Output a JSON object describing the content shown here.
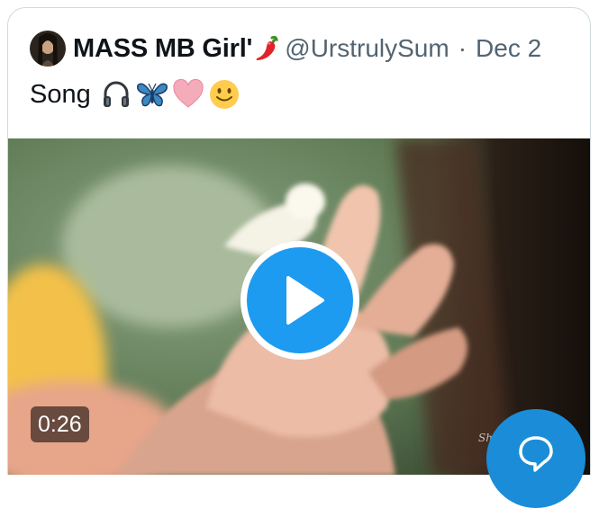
{
  "tweet": {
    "display_name": "MASS MB Girl'",
    "name_emoji_icon": "chili-pepper-icon",
    "handle": "@UrstrulySum",
    "separator": "·",
    "date": "Dec 2",
    "text": "Song",
    "text_emoji_icons": [
      "headphones-icon",
      "butterfly-icon",
      "pink-heart-icon",
      "slightly-smiling-face-icon"
    ]
  },
  "media": {
    "type": "video",
    "duration": "0:26",
    "watermark": "Shiva ka",
    "play_icon": "play-icon"
  },
  "fab": {
    "icon": "chat-bubble-icon"
  },
  "colors": {
    "accent": "#1d9bf0",
    "text_primary": "#0f1419",
    "text_secondary": "#536471",
    "border": "#cfd9de"
  }
}
